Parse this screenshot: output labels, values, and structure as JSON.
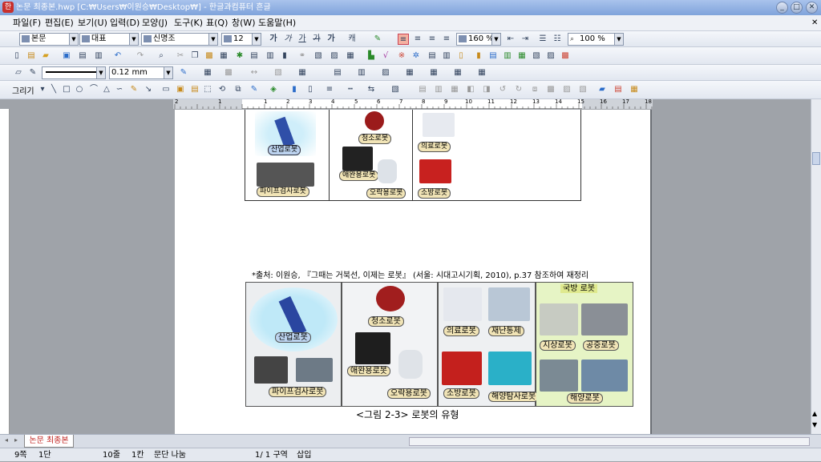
{
  "window": {
    "title": "논문 최종본.hwp [C:₩Users₩이원승₩Desktop₩] - 한글과컴퓨터 흔글",
    "app_icon": "hwp-app-icon",
    "minimize": "_",
    "maximize": "□",
    "close": "✕"
  },
  "menu": [
    "파일(F)",
    "편집(E)",
    "보기(U)",
    "입력(D)",
    "모양(J)",
    "도구(K)",
    "표(Q)",
    "창(W)",
    "도움말(H)"
  ],
  "format_toolbar": {
    "style": "본문",
    "font_lang": "대표",
    "font_name": "신명조",
    "font_size": "12",
    "bold": "가",
    "italic": "가",
    "underline": "가",
    "strike": "가",
    "outline": "가",
    "char_spacing": "160 %",
    "zoom": "100 %"
  },
  "draw_toolbar": {
    "line_width": "0.12 mm",
    "draw_label": "그리기"
  },
  "document": {
    "table1": {
      "col1": [
        "산업로봇",
        "파이프검사로봇"
      ],
      "col2": [
        "청소로봇",
        "애완용로봇",
        "오락용로봇"
      ],
      "col3": [
        "의료로봇",
        "소방로봇"
      ]
    },
    "source_caption": "*출처: 이원승, 『그때는 거북선, 이제는 로봇』 (서울: 시대고시기획, 2010),  p.37 참조하여 재정리",
    "figure": {
      "panel1": [
        "산업로봇",
        "파이프검사로봇"
      ],
      "panel2": [
        "청소로봇",
        "애완용로봇",
        "오락용로봇"
      ],
      "panel3": [
        "의료로봇",
        "재난통제",
        "소방로봇",
        "해양탐사로봇"
      ],
      "panel4_title": "국방 로봇",
      "panel4": [
        "지상로봇",
        "공중로봇",
        "해양로봇"
      ]
    },
    "figure_caption": "<그림 2-3> 로봇의 유형"
  },
  "ruler_numbers": [
    "2",
    "1",
    "1",
    "2",
    "3",
    "4",
    "5",
    "6",
    "7",
    "8",
    "9",
    "10",
    "11",
    "12",
    "13",
    "14",
    "15",
    "16",
    "17",
    "18"
  ],
  "tab": {
    "doc_name": "논문 최종본"
  },
  "status": {
    "page": "9쪽",
    "section": "1단",
    "line": "10줄",
    "col": "1칸",
    "para": "문단 나눔",
    "page_of": "1/  1 구역",
    "mode": "삽입"
  }
}
